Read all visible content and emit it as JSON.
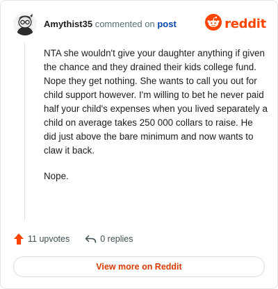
{
  "header": {
    "username": "Amythist35",
    "commented_on": "commented on",
    "post_link": "post",
    "logo_text": "reddit"
  },
  "comment": {
    "paragraphs": [
      "NTA she wouldn't give your daughter anything if given the chance and they drained their kids college fund. Nope they get nothing. She wants to call you out for child support however. I'm willing to bet he never paid half your child's expenses when you lived separately a child on average takes 250 000 collars to raise. He did just above the bare minimum and now wants to claw it back.",
      "Nope."
    ]
  },
  "actions": {
    "upvotes": "11 upvotes",
    "replies": "0 replies"
  },
  "footer": {
    "view_more": "View more on Reddit"
  },
  "colors": {
    "brand": "#ff4500",
    "upvote": "#ff4500",
    "link": "#0045ac",
    "view_more_text": "#d93a00"
  },
  "icons": {
    "avatar": "snoo-avatar",
    "logo": "reddit-snoo-icon",
    "upvote": "upvote-arrow-icon",
    "reply": "reply-arrow-icon"
  }
}
